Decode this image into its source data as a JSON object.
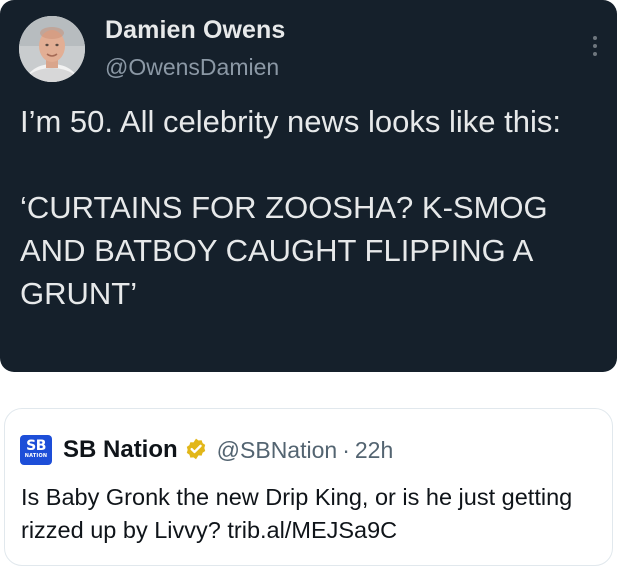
{
  "tweet": {
    "author_name": "Damien Owens",
    "author_handle": "@OwensDamien",
    "text": "I’m 50. All celebrity news looks like this:\n\n‘CURTAINS FOR ZOOSHA? K-SMOG AND BATBOY CAUGHT FLIPPING A GRUNT’",
    "more_icon": "more-horizontal-icon",
    "colors": {
      "background": "#15202b",
      "text": "#e7e9ea",
      "secondary": "#8b98a5"
    }
  },
  "quoted_tweet": {
    "logo_text": "SB",
    "logo_subtext": "NATION",
    "author_name": "SB Nation",
    "author_handle": "@SBNation",
    "separator": "·",
    "time": "22h",
    "text": "Is Baby Gronk the new Drip King, or is he just getting rizzed up by Livvy? trib.al/MEJSa9C",
    "verified_icon": "verified-badge-gold-icon",
    "colors": {
      "logo": "#1d4ed8",
      "badge": "#e2b719",
      "text": "#0f1419",
      "secondary": "#536471"
    }
  }
}
